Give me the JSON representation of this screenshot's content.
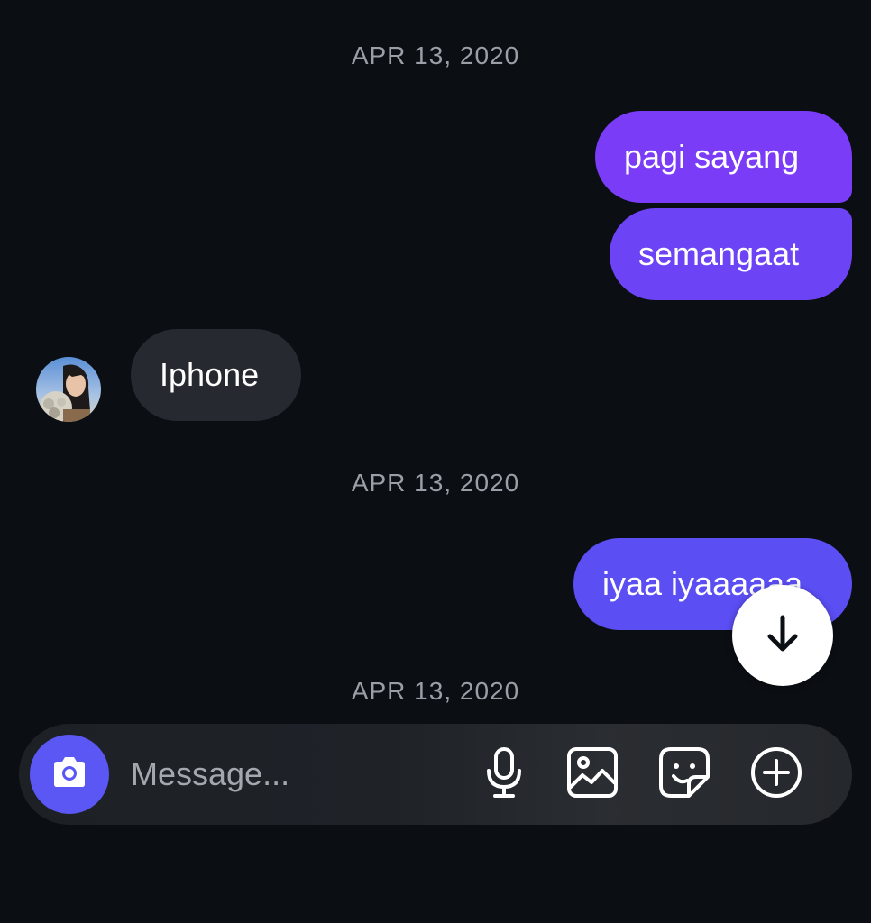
{
  "thread": {
    "dates": [
      "APR 13, 2020",
      "APR 13, 2020",
      "APR 13, 2020"
    ],
    "messages": [
      {
        "direction": "outgoing",
        "text": "pagi sayang"
      },
      {
        "direction": "outgoing",
        "text": "semangaat"
      },
      {
        "direction": "incoming",
        "text": "Iphone"
      },
      {
        "direction": "outgoing",
        "text": "iyaa iyaaaaaa"
      }
    ],
    "colors": {
      "background": "#0b0f14",
      "outgoing_gradient": [
        "#7a3cf6",
        "#6d44f5",
        "#5b4ef3"
      ],
      "incoming": "#262a30",
      "date_text": "#9a9ea6"
    }
  },
  "controls": {
    "scroll_down_icon": "arrow-down-icon"
  },
  "composer": {
    "placeholder": "Message...",
    "value": "",
    "camera_icon": "camera-icon",
    "icons": [
      "microphone-icon",
      "gallery-icon",
      "sticker-icon",
      "plus-circle-icon"
    ],
    "accent": "#5b57f5"
  }
}
